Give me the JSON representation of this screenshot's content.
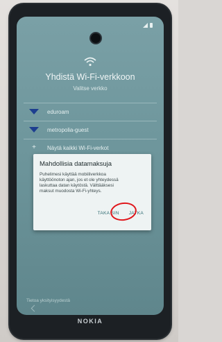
{
  "setup_screen": {
    "title": "Yhdistä Wi-Fi-verkkoon",
    "subtitle": "Valitse verkko",
    "networks": [
      {
        "name": "eduroam",
        "icon": "wifi-icon"
      },
      {
        "name": "metropolia-guest",
        "icon": "wifi-icon"
      }
    ],
    "see_all_label": "Näytä kaikki Wi-Fi-verkot",
    "footer_label": "Tietoa yksityisyydestä"
  },
  "dialog": {
    "title": "Mahdollisia datamaksuja",
    "body": "Puhelimesi käyttää mobiiliverkkoa\nkäyttöönoton ajan, jos et ole yhteydessä\nlaskuttaa datan käytöstä. Välttääksesi\nmaksut muodosta Wi-Fi-yhteys.",
    "cancel_label": "TAKA SIN",
    "continue_label": "JATKA"
  },
  "device": {
    "brand": "NOKIA"
  },
  "colors": {
    "screen_bg": "#6f979d",
    "dialog_bg": "#eef3f3",
    "accent": "#2f6b72",
    "annotation": "#e0161b"
  }
}
